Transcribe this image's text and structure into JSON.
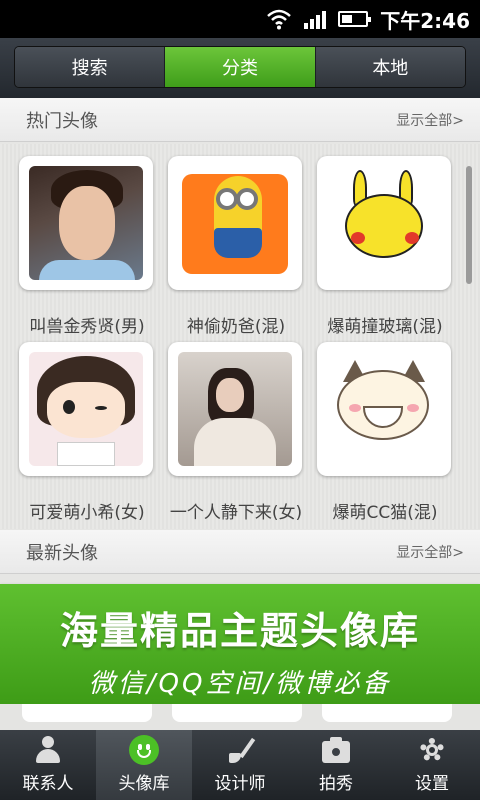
{
  "status_bar": {
    "time": "下午2:46"
  },
  "top_tabs": [
    {
      "label": "搜索",
      "active": false
    },
    {
      "label": "分类",
      "active": true
    },
    {
      "label": "本地",
      "active": false
    }
  ],
  "hot_section": {
    "title": "热门头像",
    "more": "显示全部>"
  },
  "hot_items": [
    {
      "label": "叫兽金秀贤(男)",
      "icon": "photo-man"
    },
    {
      "label": "神偷奶爸(混)",
      "icon": "minion"
    },
    {
      "label": "爆萌撞玻璃(混)",
      "icon": "pikachu"
    },
    {
      "label": "可爱萌小希(女)",
      "icon": "cartoon-girl"
    },
    {
      "label": "一个人静下来(女)",
      "icon": "photo-woman"
    },
    {
      "label": "爆萌CC猫(混)",
      "icon": "cartoon-cat"
    }
  ],
  "new_section": {
    "title": "最新头像",
    "more": "显示全部>"
  },
  "banner": {
    "main": "海量精品主题头像库",
    "sub": "微信/QQ空间/微博必备"
  },
  "bottom_tabs": [
    {
      "label": "联系人",
      "icon": "contact-icon",
      "active": false
    },
    {
      "label": "头像库",
      "icon": "smile-icon",
      "active": true
    },
    {
      "label": "设计师",
      "icon": "brush-icon",
      "active": false
    },
    {
      "label": "拍秀",
      "icon": "camera-icon",
      "active": false
    },
    {
      "label": "设置",
      "icon": "gear-icon",
      "active": false
    }
  ],
  "colors": {
    "accent_green": "#4fb326",
    "header_dark": "#2b3036"
  }
}
